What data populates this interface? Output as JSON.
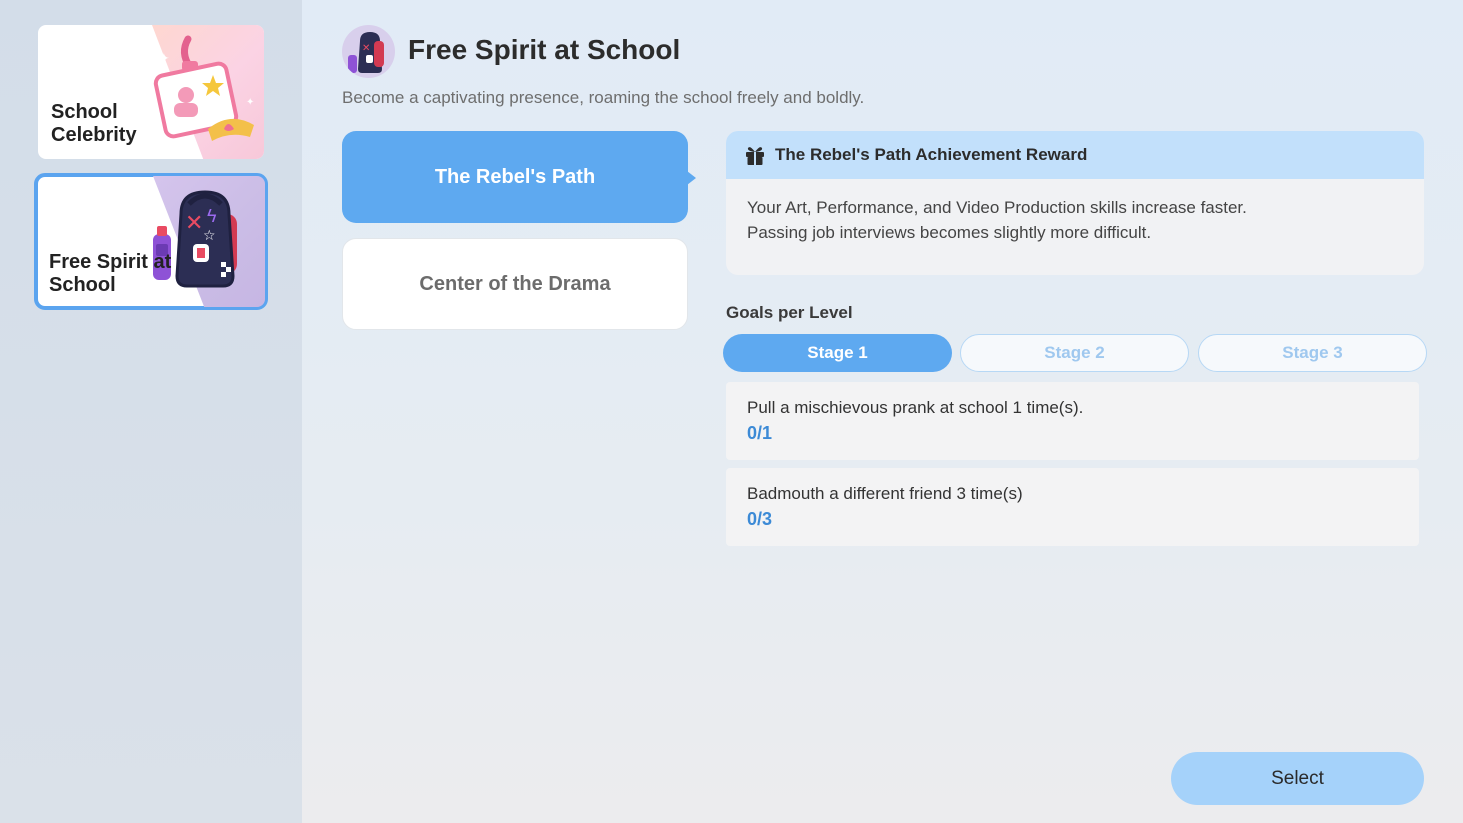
{
  "sidebar": {
    "cards": [
      {
        "label": "School Celebrity",
        "icon": "id-badge-icon",
        "selected": false
      },
      {
        "label": "Free Spirit at School",
        "icon": "backpack-icon",
        "selected": true
      }
    ]
  },
  "header": {
    "title": "Free Spirit at School",
    "subtitle": "Become a captivating presence, roaming the school freely and boldly.",
    "icon": "backpack-icon"
  },
  "paths": [
    {
      "label": "The Rebel's Path",
      "selected": true
    },
    {
      "label": "Center of the Drama",
      "selected": false
    }
  ],
  "reward": {
    "icon": "gift-icon",
    "title": "The Rebel's Path Achievement Reward",
    "lines": [
      "Your Art, Performance, and Video Production skills increase faster.",
      "Passing job interviews becomes slightly more difficult."
    ]
  },
  "goals": {
    "label": "Goals per Level",
    "stages": [
      {
        "label": "Stage 1",
        "selected": true
      },
      {
        "label": "Stage 2",
        "selected": false
      },
      {
        "label": "Stage 3",
        "selected": false
      }
    ],
    "items": [
      {
        "text": "Pull a mischievous prank at school 1 time(s).",
        "progress": "0/1"
      },
      {
        "text": "Badmouth a different friend 3 time(s)",
        "progress": "0/3"
      }
    ]
  },
  "actions": {
    "select_label": "Select"
  },
  "colors": {
    "accent": "#5ea9f0",
    "reward_header": "#c2e0fb",
    "progress_text": "#3c8ad6",
    "select_button": "#a5d2fa"
  }
}
